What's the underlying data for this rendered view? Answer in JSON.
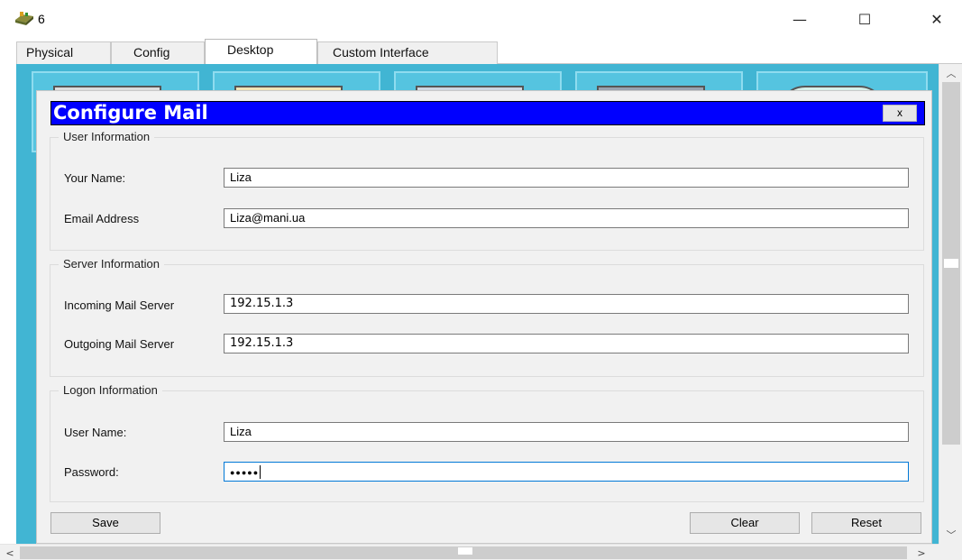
{
  "window": {
    "title": "6",
    "minimize_glyph": "—",
    "maximize_glyph": "☐",
    "close_glyph": "✕"
  },
  "tabs": [
    {
      "label": "Physical",
      "active": false
    },
    {
      "label": "Config",
      "active": false
    },
    {
      "label": "Desktop",
      "active": true
    },
    {
      "label": "Custom Interface",
      "active": false
    }
  ],
  "dialog": {
    "title": "Configure Mail",
    "close_label": "x",
    "user_info": {
      "legend": "User Information",
      "your_name_label": "Your Name:",
      "your_name_value": "Liza",
      "email_label": "Email Address",
      "email_value": "Liza@mani.ua"
    },
    "server_info": {
      "legend": "Server Information",
      "incoming_label": "Incoming Mail Server",
      "incoming_value": "192.15.1.3",
      "outgoing_label": "Outgoing Mail Server",
      "outgoing_value": "192.15.1.3"
    },
    "logon_info": {
      "legend": "Logon Information",
      "user_name_label": "User Name:",
      "user_name_value": "Liza",
      "password_label": "Password:",
      "password_value": "●●●●●"
    },
    "buttons": {
      "save": "Save",
      "clear": "Clear",
      "reset": "Reset"
    }
  },
  "scrollbars": {
    "up_arrow": "︿",
    "down_arrow": "﹀",
    "left_arrow": "<",
    "right_arrow": ">"
  },
  "colors": {
    "dialog_header": "#0000ff",
    "desktop_background": "#41b5d3",
    "focus_border": "#0078d7"
  }
}
